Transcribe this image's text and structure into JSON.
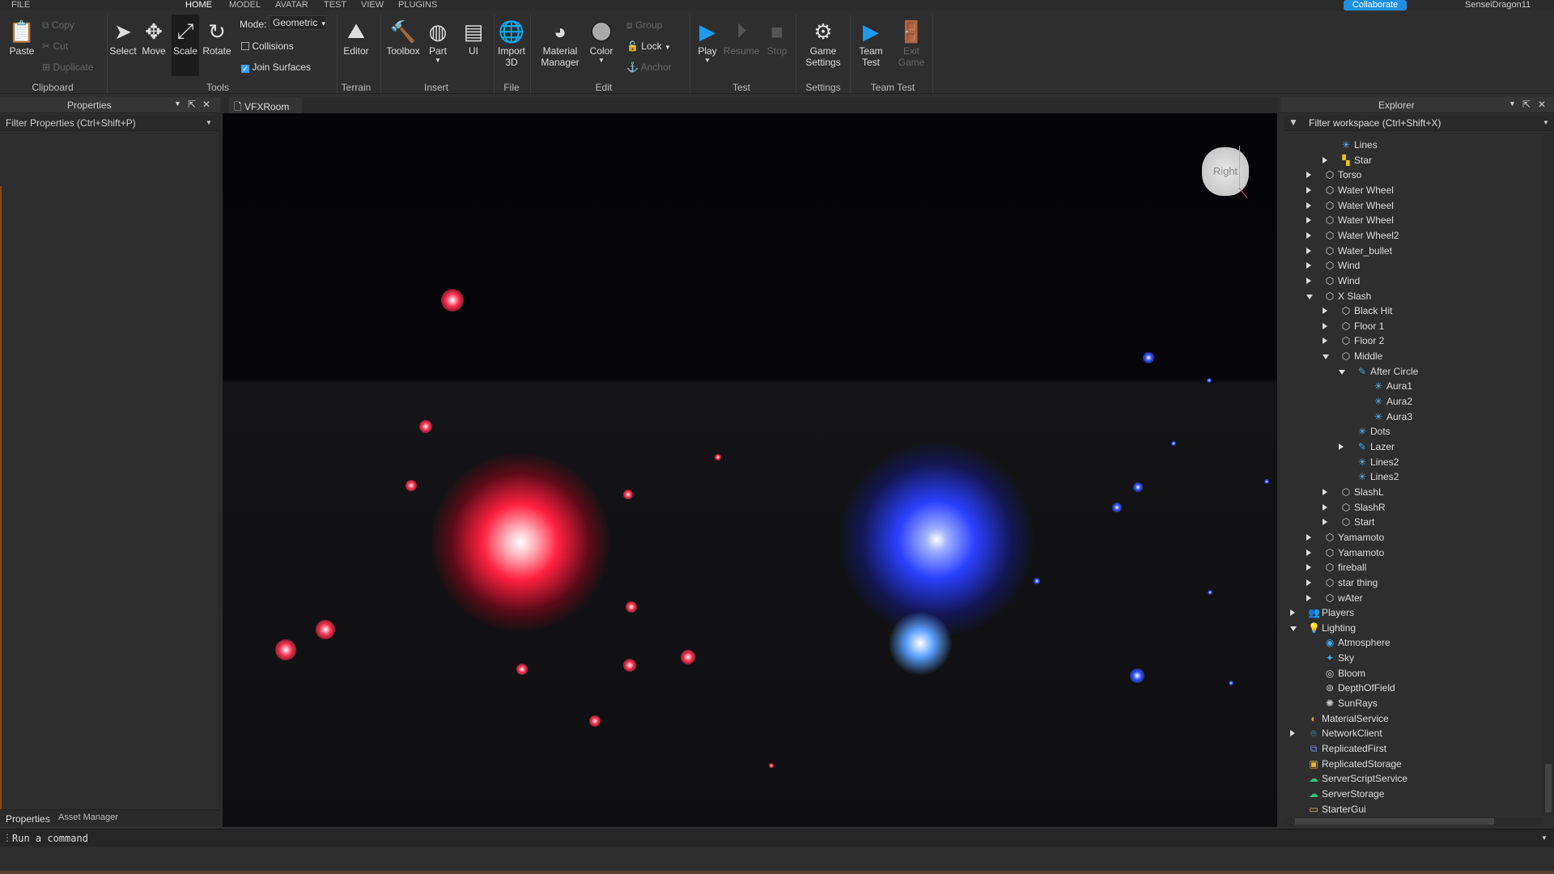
{
  "menu": {
    "items": [
      "FILE",
      "HOME",
      "MODEL",
      "AVATAR",
      "TEST",
      "VIEW",
      "PLUGINS"
    ],
    "collaborate": "Collaborate",
    "user": "SenseiDragon11"
  },
  "ribbon": {
    "clipboard": {
      "paste": "Paste",
      "copy": "Copy",
      "cut": "Cut",
      "duplicate": "Duplicate",
      "label": "Clipboard"
    },
    "tools": {
      "select": "Select",
      "move": "Move",
      "scale": "Scale",
      "rotate": "Rotate",
      "mode_label": "Mode:",
      "mode_value": "Geometric",
      "collisions": "Collisions",
      "collisions_checked": false,
      "join_surfaces": "Join Surfaces",
      "join_checked": true,
      "label": "Tools"
    },
    "terrain": {
      "editor": "Editor",
      "label": "Terrain"
    },
    "insert": {
      "toolbox": "Toolbox",
      "part": "Part",
      "ui": "UI",
      "label": "Insert"
    },
    "file": {
      "import": "Import",
      "import2": "3D",
      "label": "File"
    },
    "edit": {
      "material": "Material",
      "material2": "Manager",
      "color": "Color",
      "group": "Group",
      "lock": "Lock",
      "anchor": "Anchor",
      "label": "Edit"
    },
    "test": {
      "play": "Play",
      "resume": "Resume",
      "stop": "Stop",
      "label": "Test"
    },
    "settings": {
      "game": "Game",
      "game2": "Settings",
      "label": "Settings"
    },
    "teamtest": {
      "team": "Team",
      "team2": "Test",
      "exit": "Exit",
      "exit2": "Game",
      "label": "Team Test"
    }
  },
  "properties": {
    "title": "Properties",
    "filter_placeholder": "Filter Properties (Ctrl+Shift+P)"
  },
  "doc_tab": {
    "label": "VFXRoom"
  },
  "viewcube": {
    "label": "Right"
  },
  "explorer": {
    "title": "Explorer",
    "filter_placeholder": "Filter workspace (Ctrl+Shift+X)",
    "items": [
      {
        "name": "Lines",
        "level": 2,
        "icon": "particle",
        "state": "none"
      },
      {
        "name": "Star",
        "level": 2,
        "icon": "model-color",
        "state": "collapsed"
      },
      {
        "name": "Torso",
        "level": 1,
        "icon": "model",
        "state": "collapsed"
      },
      {
        "name": "Water Wheel",
        "level": 1,
        "icon": "model",
        "state": "collapsed"
      },
      {
        "name": "Water Wheel",
        "level": 1,
        "icon": "model",
        "state": "collapsed"
      },
      {
        "name": "Water Wheel",
        "level": 1,
        "icon": "model",
        "state": "collapsed"
      },
      {
        "name": "Water Wheel2",
        "level": 1,
        "icon": "model",
        "state": "collapsed"
      },
      {
        "name": "Water_bullet",
        "level": 1,
        "icon": "model",
        "state": "collapsed"
      },
      {
        "name": "Wind",
        "level": 1,
        "icon": "model",
        "state": "collapsed"
      },
      {
        "name": "Wind",
        "level": 1,
        "icon": "model",
        "state": "collapsed"
      },
      {
        "name": "X Slash",
        "level": 1,
        "icon": "model",
        "state": "expanded"
      },
      {
        "name": "Black Hit",
        "level": 2,
        "icon": "model",
        "state": "collapsed"
      },
      {
        "name": "Floor 1",
        "level": 2,
        "icon": "model",
        "state": "collapsed"
      },
      {
        "name": "Floor 2",
        "level": 2,
        "icon": "model",
        "state": "collapsed"
      },
      {
        "name": "Middle",
        "level": 2,
        "icon": "model",
        "state": "expanded"
      },
      {
        "name": "After Circle",
        "level": 3,
        "icon": "attachment",
        "state": "expanded"
      },
      {
        "name": "Aura1",
        "level": 4,
        "icon": "particle",
        "state": "none"
      },
      {
        "name": "Aura2",
        "level": 4,
        "icon": "particle",
        "state": "none"
      },
      {
        "name": "Aura3",
        "level": 4,
        "icon": "particle",
        "state": "none"
      },
      {
        "name": "Dots",
        "level": 3,
        "icon": "particle",
        "state": "none"
      },
      {
        "name": "Lazer",
        "level": 3,
        "icon": "attachment",
        "state": "collapsed"
      },
      {
        "name": "Lines2",
        "level": 3,
        "icon": "particle",
        "state": "none"
      },
      {
        "name": "Lines2",
        "level": 3,
        "icon": "particle",
        "state": "none"
      },
      {
        "name": "SlashL",
        "level": 2,
        "icon": "model",
        "state": "collapsed"
      },
      {
        "name": "SlashR",
        "level": 2,
        "icon": "model",
        "state": "collapsed"
      },
      {
        "name": "Start",
        "level": 2,
        "icon": "model",
        "state": "collapsed"
      },
      {
        "name": "Yamamoto",
        "level": 1,
        "icon": "model",
        "state": "collapsed"
      },
      {
        "name": "Yamamoto",
        "level": 1,
        "icon": "model",
        "state": "collapsed"
      },
      {
        "name": "fireball",
        "level": 1,
        "icon": "model",
        "state": "collapsed"
      },
      {
        "name": "star thing",
        "level": 1,
        "icon": "model",
        "state": "collapsed"
      },
      {
        "name": "wAter",
        "level": 1,
        "icon": "model",
        "state": "collapsed"
      },
      {
        "name": "Players",
        "level": 0,
        "icon": "players",
        "state": "collapsed"
      },
      {
        "name": "Lighting",
        "level": 0,
        "icon": "lighting",
        "state": "expanded"
      },
      {
        "name": "Atmosphere",
        "level": 1,
        "icon": "atmosphere",
        "state": "none"
      },
      {
        "name": "Sky",
        "level": 1,
        "icon": "sky",
        "state": "none"
      },
      {
        "name": "Bloom",
        "level": 1,
        "icon": "bloom",
        "state": "none"
      },
      {
        "name": "DepthOfField",
        "level": 1,
        "icon": "depth-of-field",
        "state": "none"
      },
      {
        "name": "SunRays",
        "level": 1,
        "icon": "sunrays",
        "state": "none"
      },
      {
        "name": "MaterialService",
        "level": 0,
        "icon": "material-service",
        "state": "none"
      },
      {
        "name": "NetworkClient",
        "level": 0,
        "icon": "network-client",
        "state": "collapsed"
      },
      {
        "name": "ReplicatedFirst",
        "level": 0,
        "icon": "replicated-first",
        "state": "none"
      },
      {
        "name": "ReplicatedStorage",
        "level": 0,
        "icon": "replicated-storage",
        "state": "none"
      },
      {
        "name": "ServerScriptService",
        "level": 0,
        "icon": "server-script-service",
        "state": "none"
      },
      {
        "name": "ServerStorage",
        "level": 0,
        "icon": "server-storage",
        "state": "none"
      },
      {
        "name": "StarterGui",
        "level": 0,
        "icon": "starter-gui",
        "state": "none"
      }
    ]
  },
  "bottom_tabs": [
    "Properties",
    "Asset Manager"
  ],
  "command_bar": {
    "placeholder": "Run a command"
  },
  "colors": {
    "accent": "#1e8fe0",
    "red_fx": "#ff2a40",
    "blue_fx": "#2a4bff"
  }
}
